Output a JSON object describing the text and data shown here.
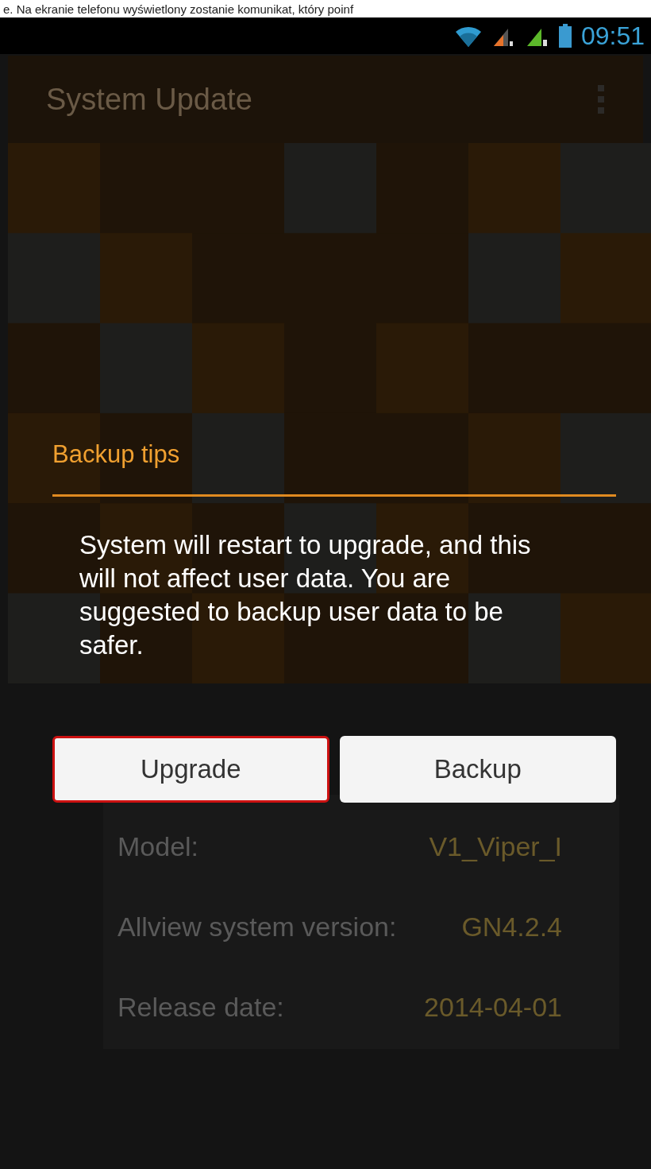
{
  "caption": "e. Na ekranie telefonu wyświetlony zostanie komunikat, który poinf",
  "status_bar": {
    "time": "09:51"
  },
  "action_bar": {
    "title": "System Update"
  },
  "info": [
    {
      "label": "Model:",
      "value": "V1_Viper_I"
    },
    {
      "label": "Allview system version:",
      "value": "GN4.2.4"
    },
    {
      "label": "Release date:",
      "value": "2014-04-01"
    }
  ],
  "dialog": {
    "title": "Backup tips",
    "message": "System will restart to upgrade, and this will not affect user data. You are suggested to backup user data to be safer.",
    "buttons": [
      {
        "label": "Upgrade",
        "highlighted": true
      },
      {
        "label": "Backup",
        "highlighted": false
      }
    ]
  }
}
